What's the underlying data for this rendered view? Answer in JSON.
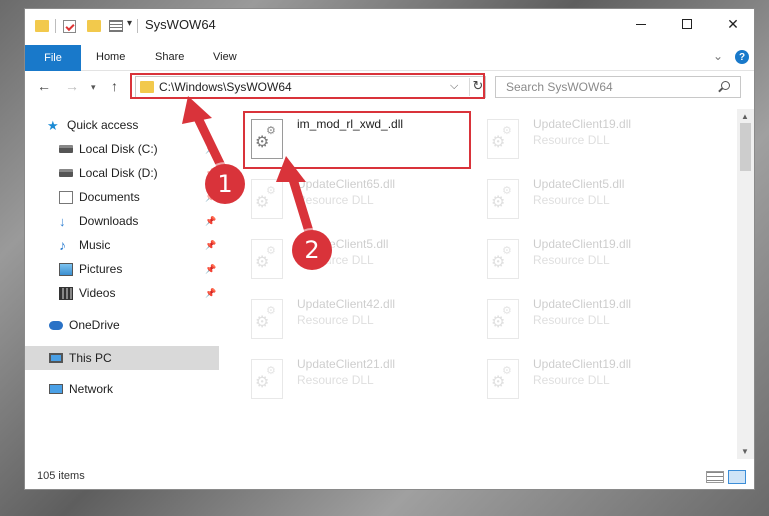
{
  "window": {
    "title": "SysWOW64",
    "min_symbol": "",
    "max_symbol": "",
    "close_symbol": "✕"
  },
  "ribbon": {
    "tabs": [
      "File",
      "Home",
      "Share",
      "View"
    ],
    "help_symbol": "?"
  },
  "nav": {
    "back": "←",
    "forward": "→",
    "recent": "▾",
    "up": "↑",
    "address": "C:\\Windows\\SysWOW64",
    "address_dropdown": "⌵",
    "refresh": "↻",
    "search_placeholder": "Search SysWOW64"
  },
  "sidebar": {
    "items": [
      {
        "label": "Quick access",
        "icon": "star-icon",
        "pinned": false
      },
      {
        "label": "Local Disk (C:)",
        "icon": "drive-icon",
        "pinned": true
      },
      {
        "label": "Local Disk (D:)",
        "icon": "drive-icon",
        "pinned": true
      },
      {
        "label": "Documents",
        "icon": "documents-icon",
        "pinned": true
      },
      {
        "label": "Downloads",
        "icon": "downloads-icon",
        "pinned": true
      },
      {
        "label": "Music",
        "icon": "music-icon",
        "pinned": true
      },
      {
        "label": "Pictures",
        "icon": "pictures-icon",
        "pinned": true
      },
      {
        "label": "Videos",
        "icon": "videos-icon",
        "pinned": true
      },
      {
        "label": "OneDrive",
        "icon": "onedrive-icon",
        "pinned": false
      },
      {
        "label": "This PC",
        "icon": "this-pc-icon",
        "pinned": false,
        "selected": true
      },
      {
        "label": "Network",
        "icon": "network-icon",
        "pinned": false
      }
    ],
    "pin_symbol": "📌"
  },
  "files": {
    "highlighted": {
      "name": "im_mod_rl_xwd_.dll",
      "type": ""
    },
    "faded": [
      {
        "name": "UpdateClient19.dll",
        "type": "Resource DLL"
      },
      {
        "name": "UpdateClient65.dll",
        "type": "Resource DLL"
      },
      {
        "name": "UpdateClient5.dll",
        "type": "Resource DLL"
      },
      {
        "name": "UpdateClient5.dll",
        "type": "Resource DLL"
      },
      {
        "name": "UpdateClient19.dll",
        "type": "Resource DLL"
      },
      {
        "name": "UpdateClient42.dll",
        "type": "Resource DLL"
      },
      {
        "name": "UpdateClient19.dll",
        "type": "Resource DLL"
      },
      {
        "name": "UpdateClient21.dll",
        "type": "Resource DLL"
      },
      {
        "name": "UpdateClient19.dll",
        "type": "Resource DLL"
      }
    ]
  },
  "status": {
    "item_count": "105 items"
  },
  "annotations": {
    "step1": "1",
    "step2": "2",
    "color": "#d9333a"
  }
}
